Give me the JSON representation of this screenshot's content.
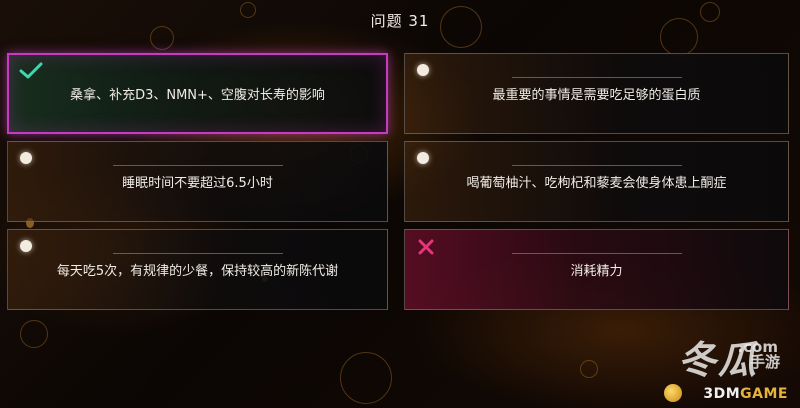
{
  "quiz": {
    "title": "问题 31",
    "options": [
      {
        "label": "桑拿、补充D3、NMN+、空腹对长寿的影响",
        "state": "selected-correct"
      },
      {
        "label": "最重要的事情是需要吃足够的蛋白质",
        "state": "unselected"
      },
      {
        "label": "睡眠时间不要超过6.5小时",
        "state": "unselected"
      },
      {
        "label": "喝葡萄柚汁、吃枸杞和藜麦会使身体患上酮症",
        "state": "unselected"
      },
      {
        "label": "每天吃5次，有规律的少餐，保持较高的新陈代谢",
        "state": "unselected"
      },
      {
        "label": "消耗精力",
        "state": "wrong"
      }
    ]
  },
  "watermark": {
    "main": "冬瓜",
    "secondary": "手游",
    "url": ".com",
    "brand_prefix": "3DM",
    "brand_suffix": "GAME"
  },
  "colors": {
    "selected_border": "#c63cc0",
    "check": "#3fd6b0",
    "cross": "#e8357a"
  }
}
